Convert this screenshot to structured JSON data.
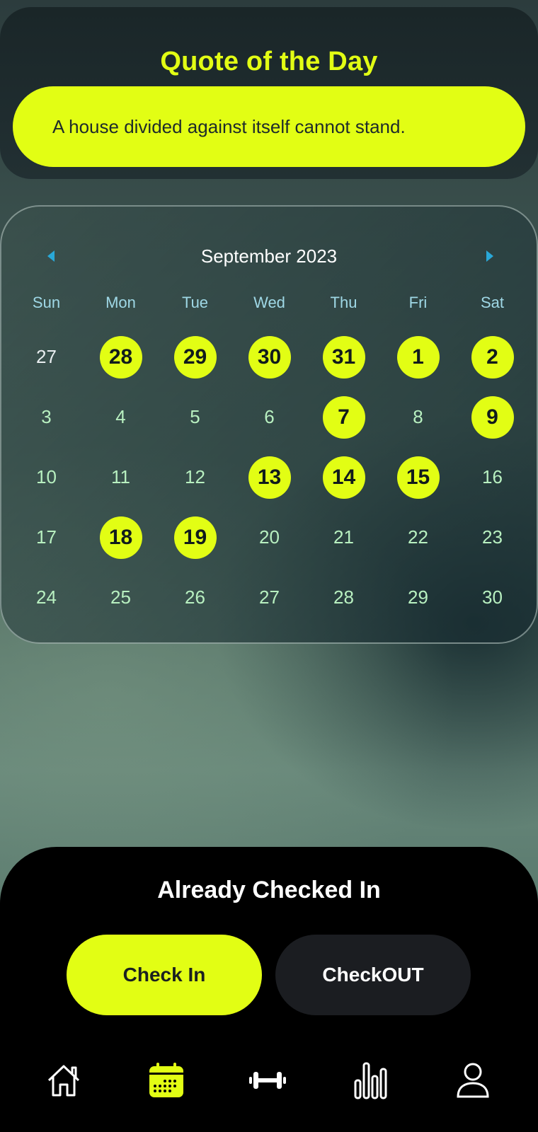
{
  "quote": {
    "title": "Quote of the Day",
    "text": "A house divided against itself cannot stand."
  },
  "calendar": {
    "month_label": "September 2023",
    "prev_icon": "chevron-left-icon",
    "next_icon": "chevron-right-icon",
    "weekdays": [
      "Sun",
      "Mon",
      "Tue",
      "Wed",
      "Thu",
      "Fri",
      "Sat"
    ],
    "days": [
      {
        "label": "27",
        "outside_month": true,
        "checked": false
      },
      {
        "label": "28",
        "outside_month": true,
        "checked": true
      },
      {
        "label": "29",
        "outside_month": true,
        "checked": true
      },
      {
        "label": "30",
        "outside_month": true,
        "checked": true
      },
      {
        "label": "31",
        "outside_month": true,
        "checked": true
      },
      {
        "label": "1",
        "outside_month": false,
        "checked": true
      },
      {
        "label": "2",
        "outside_month": false,
        "checked": true
      },
      {
        "label": "3",
        "outside_month": false,
        "checked": false
      },
      {
        "label": "4",
        "outside_month": false,
        "checked": false
      },
      {
        "label": "5",
        "outside_month": false,
        "checked": false
      },
      {
        "label": "6",
        "outside_month": false,
        "checked": false
      },
      {
        "label": "7",
        "outside_month": false,
        "checked": true
      },
      {
        "label": "8",
        "outside_month": false,
        "checked": false
      },
      {
        "label": "9",
        "outside_month": false,
        "checked": true
      },
      {
        "label": "10",
        "outside_month": false,
        "checked": false
      },
      {
        "label": "11",
        "outside_month": false,
        "checked": false
      },
      {
        "label": "12",
        "outside_month": false,
        "checked": false
      },
      {
        "label": "13",
        "outside_month": false,
        "checked": true
      },
      {
        "label": "14",
        "outside_month": false,
        "checked": true
      },
      {
        "label": "15",
        "outside_month": false,
        "checked": true
      },
      {
        "label": "16",
        "outside_month": false,
        "checked": false
      },
      {
        "label": "17",
        "outside_month": false,
        "checked": false
      },
      {
        "label": "18",
        "outside_month": false,
        "checked": true
      },
      {
        "label": "19",
        "outside_month": false,
        "checked": true
      },
      {
        "label": "20",
        "outside_month": false,
        "checked": false
      },
      {
        "label": "21",
        "outside_month": false,
        "checked": false
      },
      {
        "label": "22",
        "outside_month": false,
        "checked": false
      },
      {
        "label": "23",
        "outside_month": false,
        "checked": false
      },
      {
        "label": "24",
        "outside_month": false,
        "checked": false
      },
      {
        "label": "25",
        "outside_month": false,
        "checked": false
      },
      {
        "label": "26",
        "outside_month": false,
        "checked": false
      },
      {
        "label": "27",
        "outside_month": false,
        "checked": false
      },
      {
        "label": "28",
        "outside_month": false,
        "checked": false
      },
      {
        "label": "29",
        "outside_month": false,
        "checked": false
      },
      {
        "label": "30",
        "outside_month": false,
        "checked": false
      }
    ]
  },
  "checkin": {
    "status": "Already Checked In",
    "checkin_label": "Check In",
    "checkout_label": "CheckOUT"
  },
  "nav": {
    "items": [
      {
        "icon": "home-icon",
        "active": false
      },
      {
        "icon": "calendar-icon",
        "active": true
      },
      {
        "icon": "dumbbell-icon",
        "active": false
      },
      {
        "icon": "bar-chart-icon",
        "active": false
      },
      {
        "icon": "user-icon",
        "active": false
      }
    ]
  },
  "colors": {
    "accent": "#e2fe14",
    "nav_arrow": "#29a8d8",
    "day_text": "#b8f0c0",
    "weekday_text": "#9fd8e6",
    "panel": "#000000"
  }
}
